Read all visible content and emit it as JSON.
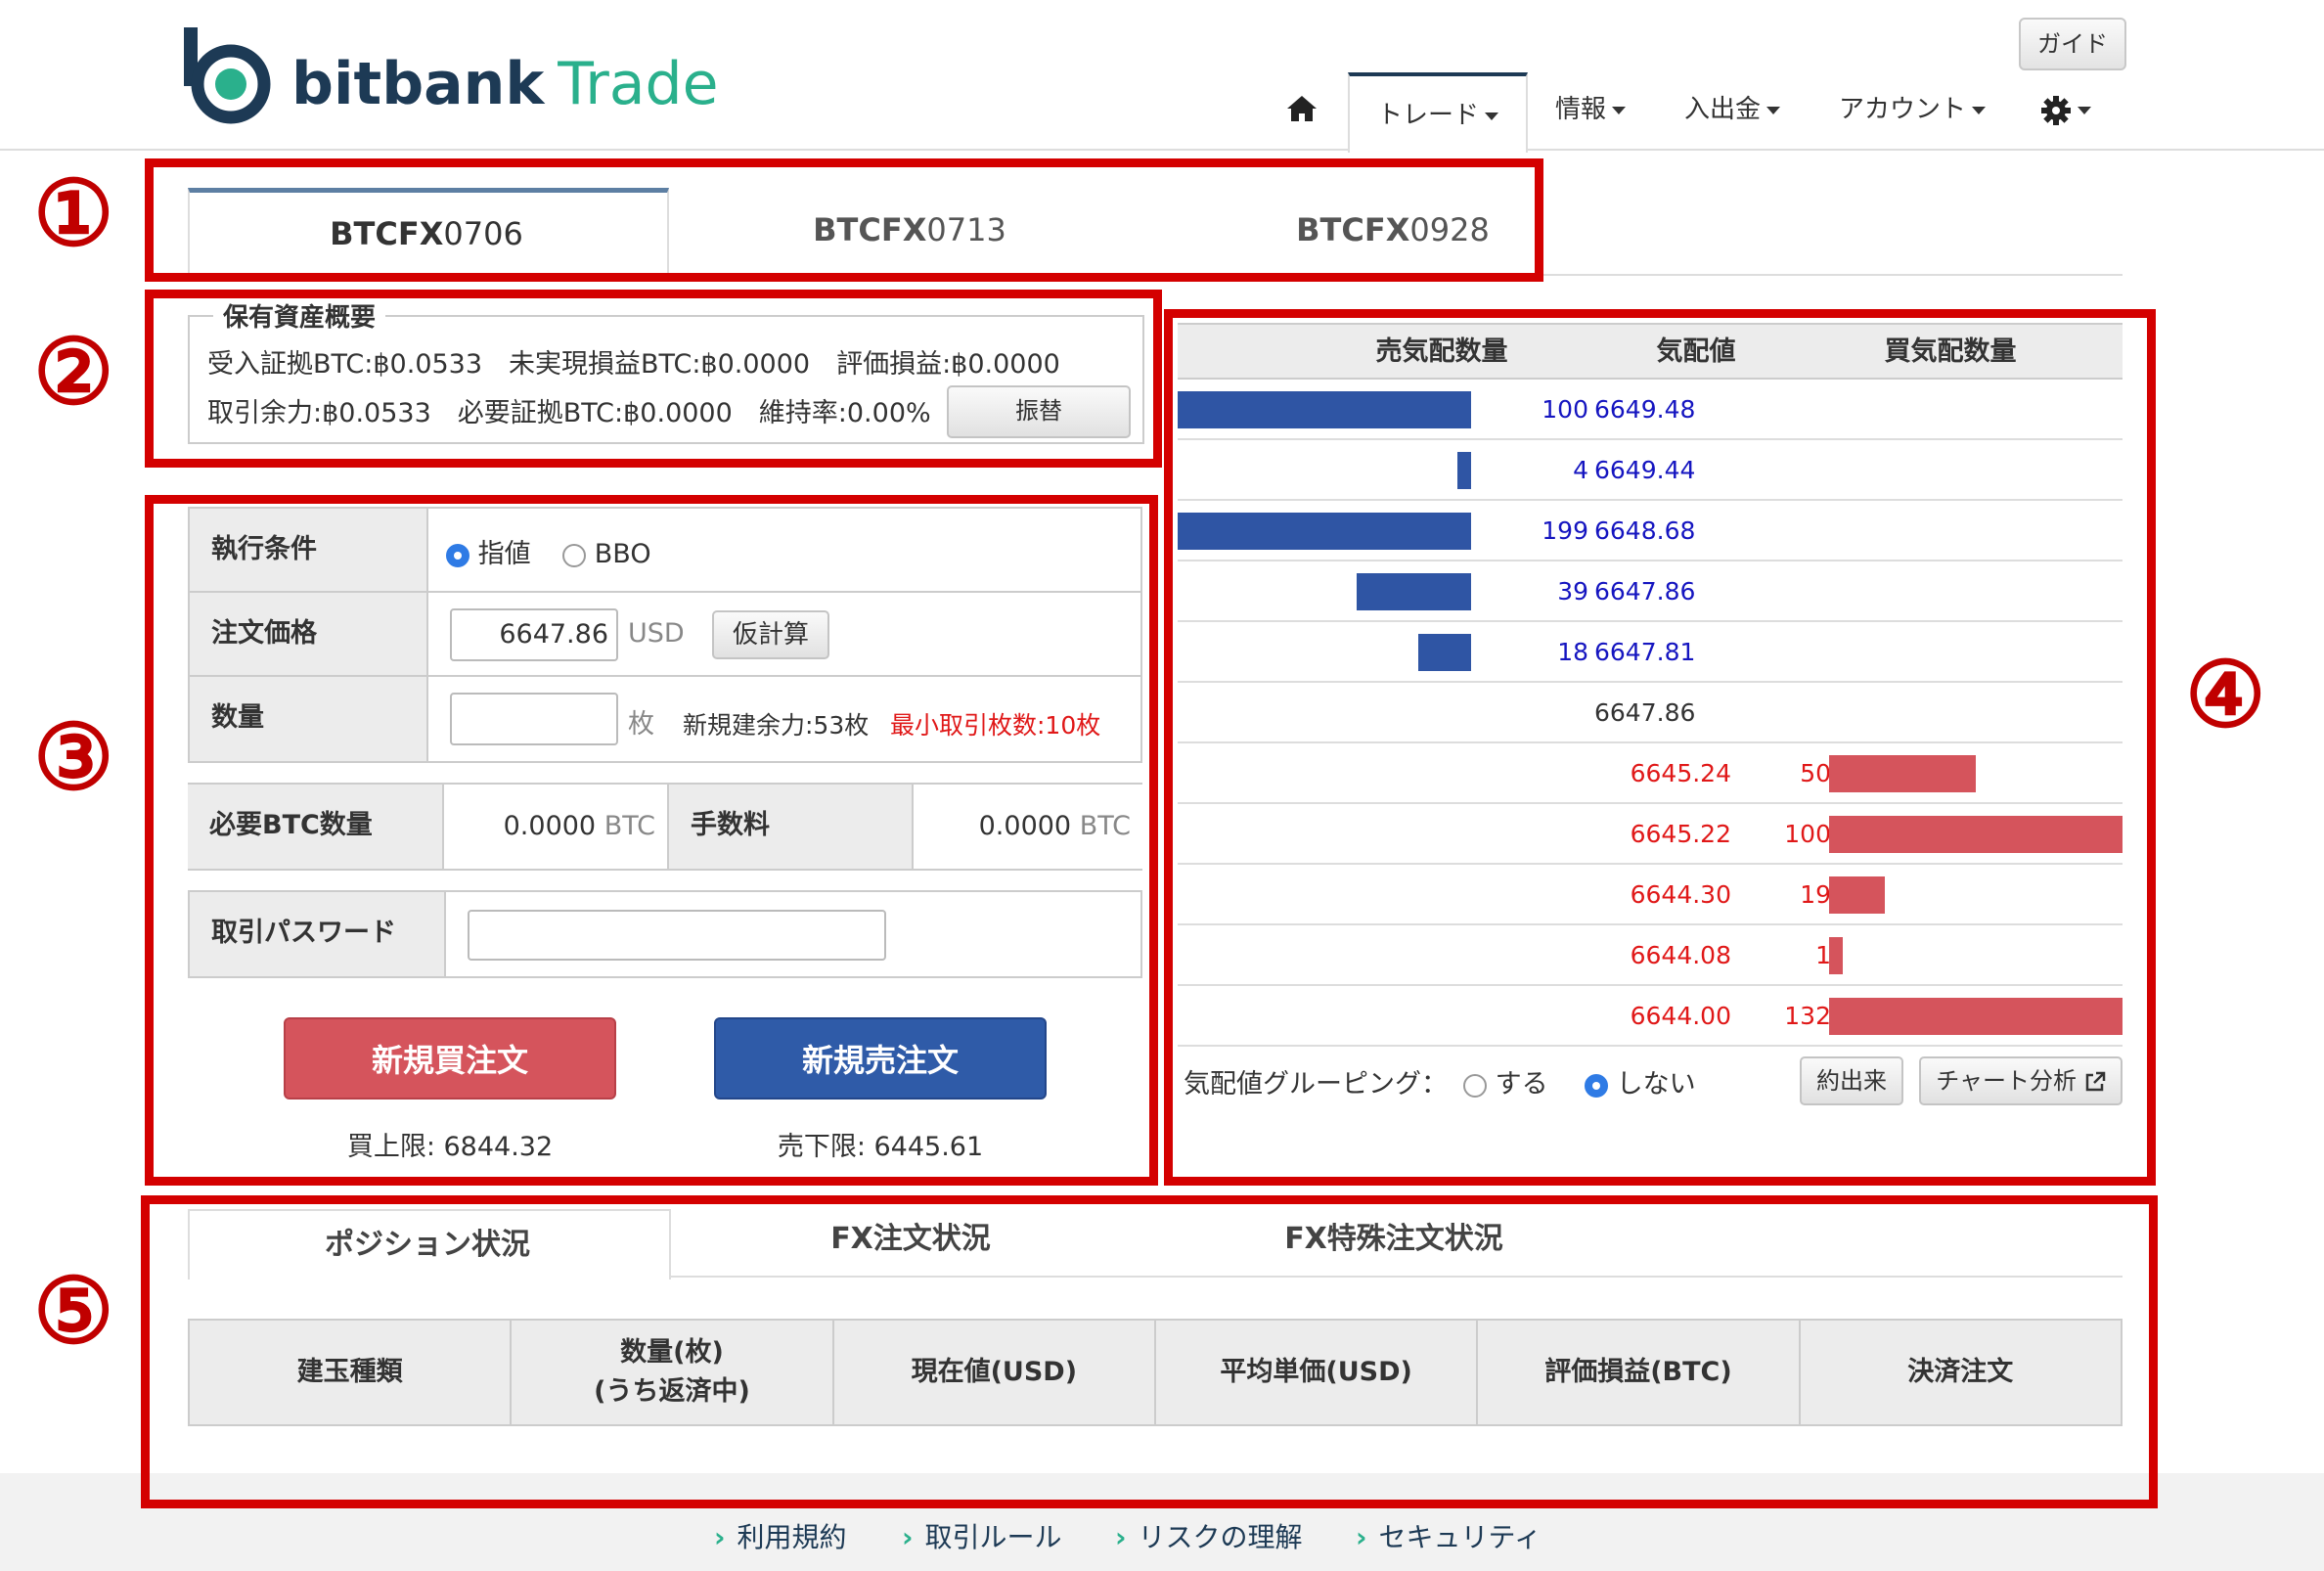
{
  "header": {
    "logo_word1": "bitbank",
    "logo_word2": "Trade",
    "guide_label": "ガイド",
    "nav": {
      "home_icon": "home-icon",
      "trade": "トレード",
      "info": "情報",
      "deposit": "入出金",
      "account": "アカウント",
      "settings_icon": "gear-icon"
    }
  },
  "annotations": [
    "①",
    "②",
    "③",
    "④",
    "⑤"
  ],
  "contract_tabs": [
    {
      "prefix": "BTCFX",
      "suffix": "0706"
    },
    {
      "prefix": "BTCFX",
      "suffix": "0713"
    },
    {
      "prefix": "BTCFX",
      "suffix": "0928"
    }
  ],
  "asset_summary": {
    "title": "保有資産概要",
    "line1": "受入証拠BTC:฿0.0533　未実現損益BTC:฿0.0000　評価損益:฿0.0000",
    "line2": "取引余力:฿0.0533　必要証拠BTC:฿0.0000　維持率:0.00%",
    "transfer_label": "振替"
  },
  "order_form": {
    "exec_label": "執行条件",
    "opt_limit": "指値",
    "opt_bbo": "BBO",
    "price_label": "注文価格",
    "price_value": "6647.86",
    "price_unit": "USD",
    "calc_label": "仮計算",
    "qty_label": "数量",
    "qty_value": "",
    "qty_unit": "枚",
    "capacity": "新規建余力:53枚",
    "min_lots": "最小取引枚数:10枚",
    "req_btc_label": "必要BTC数量",
    "req_btc_value": "0.0000",
    "btc_unit": "BTC",
    "fee_label": "手数料",
    "fee_value": "0.0000",
    "password_label": "取引パスワード",
    "password_value": "",
    "buy_label": "新規買注文",
    "sell_label": "新規売注文",
    "buy_limit": "買上限: 6844.32",
    "sell_limit": "売下限: 6445.61"
  },
  "order_book": {
    "col_ask_qty": "売気配数量",
    "col_price": "気配値",
    "col_bid_qty": "買気配数量",
    "asks": [
      {
        "qty": "100",
        "price": "6649.48"
      },
      {
        "qty": "4",
        "price": "6649.44"
      },
      {
        "qty": "199",
        "price": "6648.68"
      },
      {
        "qty": "39",
        "price": "6647.86"
      },
      {
        "qty": "18",
        "price": "6647.81"
      }
    ],
    "mid_price": "6647.86",
    "bids": [
      {
        "price": "6645.24",
        "qty": "50"
      },
      {
        "price": "6645.22",
        "qty": "100"
      },
      {
        "price": "6644.30",
        "qty": "19"
      },
      {
        "price": "6644.08",
        "qty": "1"
      },
      {
        "price": "6644.00",
        "qty": "132"
      }
    ],
    "grouping_label": "気配値グルーピング：",
    "grouping_on": "する",
    "grouping_off": "しない",
    "trades_btn": "約出来",
    "chart_btn": "チャート分析"
  },
  "positions": {
    "tabs": [
      "ポジション状況",
      "FX注文状況",
      "FX特殊注文状況"
    ],
    "columns": [
      "建玉種類",
      "数量(枚)\n(うち返済中)",
      "現在値(USD)",
      "平均単価(USD)",
      "評価損益(BTC)",
      "決済注文"
    ]
  },
  "footer": {
    "links": [
      "利用規約",
      "取引ルール",
      "リスクの理解",
      "セキュリティ"
    ]
  },
  "colors": {
    "annotation_red": "#d40000",
    "ask_blue": "#2f55a4",
    "bid_red": "#d5545c",
    "brand_navy": "#1d3a55",
    "brand_green": "#2ab08c"
  }
}
